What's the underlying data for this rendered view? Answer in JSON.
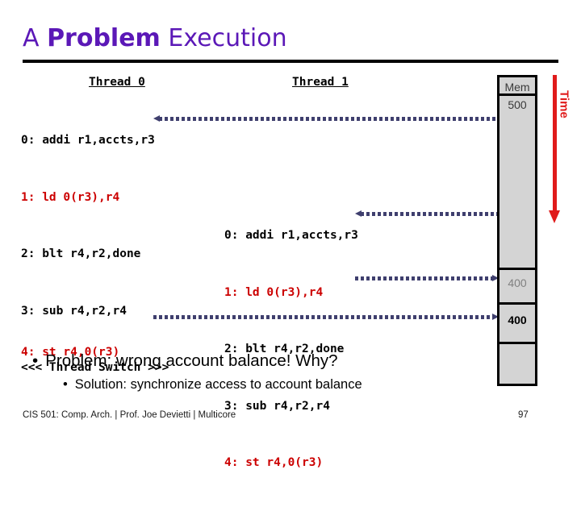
{
  "slide": {
    "title_plain_before": "A ",
    "title_bold": "Problem",
    "title_plain_after": " Execution",
    "title_color": "#5B18B7"
  },
  "threads": [
    {
      "header": "Thread 0",
      "lines": [
        {
          "text": "0: addi r1,accts,r3",
          "color": "black"
        },
        {
          "text": "1: ld 0(r3),r4",
          "color": "red"
        },
        {
          "text": "2: blt r4,r2,done",
          "color": "black"
        },
        {
          "text": "3: sub r4,r2,r4",
          "color": "black"
        },
        {
          "text": "<<< Thread Switch >>>",
          "color": "black"
        }
      ],
      "late_line": {
        "text": "4: st r4,0(r3)",
        "color": "red"
      }
    },
    {
      "header": "Thread 1",
      "lines": [
        {
          "text": "0: addi r1,accts,r3",
          "color": "black"
        },
        {
          "text": "1: ld 0(r3),r4",
          "color": "red"
        },
        {
          "text": "2: blt r4,r2,done",
          "color": "black"
        },
        {
          "text": "3: sub r4,r2,r4",
          "color": "black"
        },
        {
          "text": "4: st r4,0(r3)",
          "color": "red"
        }
      ]
    }
  ],
  "memory": {
    "header": "Mem",
    "cells": [
      {
        "value": "500",
        "style": "initial"
      },
      {
        "value": "400",
        "style": "gray"
      },
      {
        "value": "400",
        "style": "bold"
      }
    ]
  },
  "time_axis": {
    "label": "Time",
    "color": "#E01B1B"
  },
  "arrows": {
    "color": "#3F3F6E",
    "items": [
      {
        "name": "t0-load-from-mem",
        "direction": "left"
      },
      {
        "name": "t1-load-from-mem",
        "direction": "left"
      },
      {
        "name": "t1-store-to-mem",
        "direction": "right"
      },
      {
        "name": "t0-store-to-mem",
        "direction": "right"
      }
    ]
  },
  "bullets": {
    "bullet_glyph": "•",
    "level1": "Problem: wrong account balance!  Why?",
    "level2": "Solution: synchronize access to account balance"
  },
  "footer": {
    "text": "CIS 501: Comp. Arch.  |  Prof. Joe Devietti  |  Multicore",
    "page": "97"
  }
}
